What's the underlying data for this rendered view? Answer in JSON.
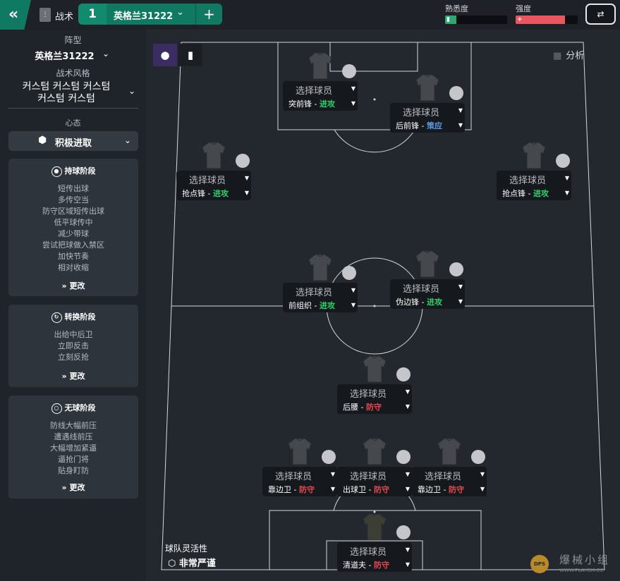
{
  "topbar": {
    "tactics_label": "战术",
    "tab_number": "1",
    "tab_name": "英格兰31222",
    "familiarity_label": "熟悉度",
    "familiarity_value": 0.18,
    "intensity_label": "强度",
    "intensity_value": 0.8,
    "colors": {
      "accent": "#0f7a61",
      "familiarity": "#2aa86f",
      "intensity": "#e8575d"
    }
  },
  "sidebar": {
    "formation_label": "阵型",
    "formation_value": "英格兰31222",
    "style_label": "战术风格",
    "style_lines": [
      "커스텀 커스텀 커스텀",
      "커스텀 커스텀"
    ],
    "mentality_label": "心态",
    "mentality_value": "积极进取",
    "in_possession": {
      "title": "持球阶段",
      "items": [
        "短传出球",
        "多传空当",
        "防守区域短传出球",
        "低平球传中",
        "减少带球",
        "尝试把球做入禁区",
        "加快节奏",
        "相对收缩"
      ],
      "change": "更改"
    },
    "transition": {
      "title": "转换阶段",
      "items": [
        "出给中后卫",
        "立即反击",
        "立刻反抢"
      ],
      "change": "更改"
    },
    "out_of_possession": {
      "title": "无球阶段",
      "items": [
        "防线大幅前压",
        "遭遇线前压",
        "大幅增加紧逼",
        "逼抢门将",
        "贴身盯防"
      ],
      "change": "更改"
    }
  },
  "pitch": {
    "analysis_label": "分析",
    "select_label": "选择球员",
    "duties": {
      "attack": "进攻",
      "support": "策应",
      "defend": "防守"
    },
    "players": [
      {
        "role": "突前锋",
        "duty": "attack"
      },
      {
        "role": "后前锋",
        "duty": "support"
      },
      {
        "role": "抢点锋",
        "duty": "attack"
      },
      {
        "role": "抢点锋",
        "duty": "attack"
      },
      {
        "role": "前组织",
        "duty": "attack"
      },
      {
        "role": "伪边锋",
        "duty": "attack"
      },
      {
        "role": "后腰",
        "duty": "defend"
      },
      {
        "role": "靠边卫",
        "duty": "defend"
      },
      {
        "role": "出球卫",
        "duty": "defend"
      },
      {
        "role": "靠边卫",
        "duty": "defend"
      },
      {
        "role": "清道夫",
        "duty": "defend"
      }
    ],
    "fluidity_label": "球队灵活性",
    "fluidity_value": "非常严谨"
  },
  "watermark": {
    "text": "爆械小组",
    "url": "WWW.PLAYGM.CC",
    "logo": "DPS"
  }
}
